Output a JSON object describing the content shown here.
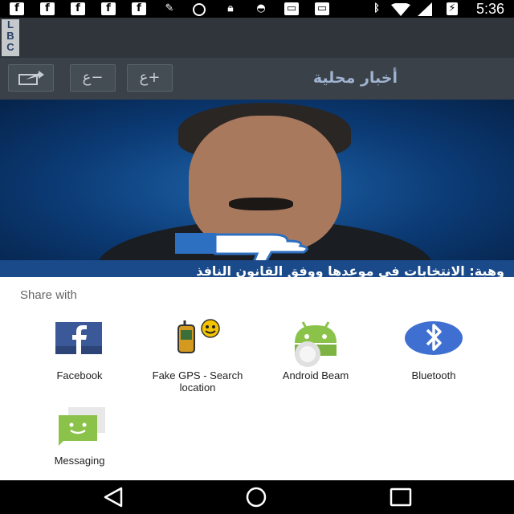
{
  "status_bar": {
    "time": "5:36",
    "notification_icons": [
      "facebook-icon",
      "facebook-icon",
      "facebook-icon",
      "facebook-icon",
      "facebook-icon",
      "fake-gps-icon",
      "sync-icon",
      "lock-icon",
      "android-icon",
      "shopping-bag-icon",
      "shopping-bag-icon"
    ],
    "system_icons": [
      "bluetooth-icon",
      "wifi-icon",
      "signal-icon",
      "battery-icon"
    ]
  },
  "app": {
    "logo_text": "LBC",
    "toolbar": {
      "title": "أخبار محلية",
      "font_increase_label": "ع+",
      "font_decrease_label": "ع−"
    },
    "headline": "وهبة: الانتخابات في موعدها ووفق القانون النافذ"
  },
  "share_sheet": {
    "title": "Share with",
    "targets": [
      {
        "label": "Facebook"
      },
      {
        "label": "Fake GPS - Search location"
      },
      {
        "label": "Android Beam"
      },
      {
        "label": "Bluetooth"
      },
      {
        "label": "Messaging"
      }
    ]
  },
  "colors": {
    "accent_blue": "#3b78c4",
    "facebook_blue": "#3b5998",
    "android_green": "#8bc34a",
    "bluetooth_blue": "#3f6fd1"
  }
}
